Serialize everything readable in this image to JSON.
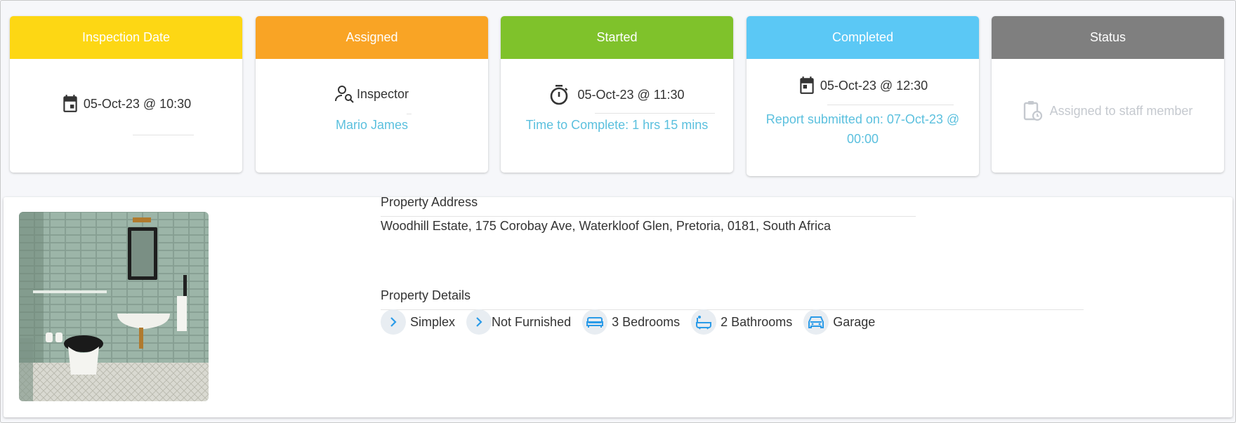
{
  "cards": {
    "inspection": {
      "title": "Inspection Date",
      "value": "05-Oct-23 @ 10:30",
      "color": "#fdd714"
    },
    "assigned": {
      "title": "Assigned",
      "role": "Inspector",
      "name": "Mario James",
      "color": "#f9a425"
    },
    "started": {
      "title": "Started",
      "value": "05-Oct-23 @ 11:30",
      "duration": "Time to Complete: 1 hrs 15 mins",
      "color": "#7fc22b"
    },
    "completed": {
      "title": "Completed",
      "value": "05-Oct-23 @ 12:30",
      "report_line1": "Report submitted on: 07-Oct-23 @",
      "report_line2": "00:00",
      "color": "#5bc8f5"
    },
    "status": {
      "title": "Status",
      "value": "Assigned to staff member",
      "color": "#7f7f7f"
    }
  },
  "property": {
    "address_label": "Property Address",
    "address": "Woodhill Estate, 175 Corobay Ave, Waterkloof Glen, Pretoria, 0181, South Africa",
    "details_label": "Property Details",
    "details": [
      {
        "label": "Simplex",
        "icon": "chevron-right-icon"
      },
      {
        "label": "Not Furnished",
        "icon": "chevron-right-icon"
      },
      {
        "label": "3 Bedrooms",
        "icon": "bed-icon"
      },
      {
        "label": "2 Bathrooms",
        "icon": "bathtub-icon"
      },
      {
        "label": "Garage",
        "icon": "car-icon"
      }
    ]
  },
  "colors": {
    "link": "#5bc0de",
    "icon_blue": "#2b9be8",
    "muted": "#c5c9cf"
  }
}
